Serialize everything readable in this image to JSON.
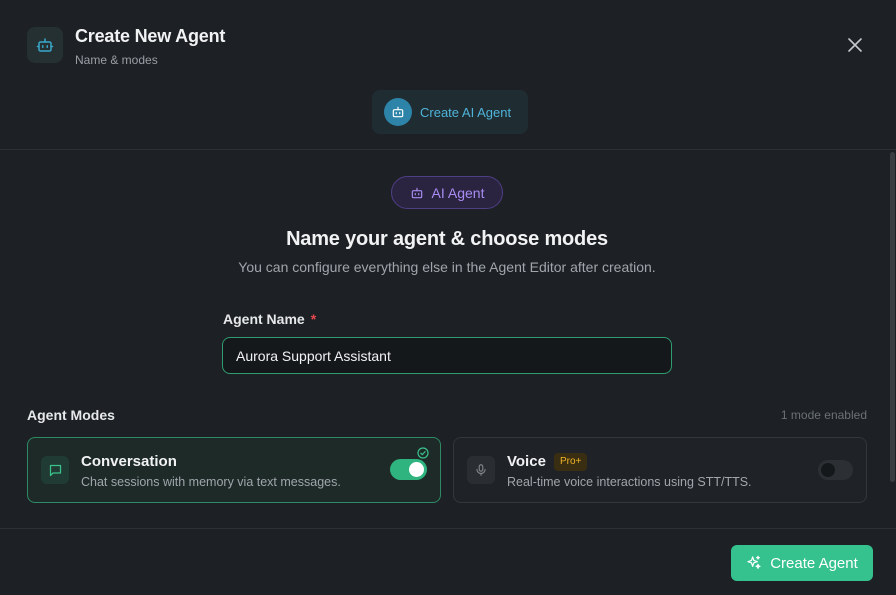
{
  "header": {
    "title": "Create New Agent",
    "subtitle": "Name & modes",
    "step_label": "Create AI Agent",
    "icon": "bot-icon"
  },
  "main": {
    "badge_label": "AI Agent",
    "heading": "Name your agent & choose modes",
    "description": "You can configure everything else in the Agent Editor after creation.",
    "name_field": {
      "label": "Agent Name",
      "required_mark": "*",
      "value": "Aurora Support Assistant"
    },
    "modes": {
      "title": "Agent Modes",
      "count_text": "1 mode enabled",
      "items": [
        {
          "title": "Conversation",
          "description": "Chat sessions with memory via text messages.",
          "enabled": true,
          "icon": "chat-bubble-icon"
        },
        {
          "title": "Voice",
          "tag": "Pro+",
          "description": "Real-time voice interactions using STT/TTS.",
          "enabled": false,
          "icon": "microphone-icon"
        }
      ]
    }
  },
  "footer": {
    "create_label": "Create Agent",
    "icon": "sparkles-icon"
  },
  "colors": {
    "accent_green": "#35c28f",
    "accent_purple": "#a88cf2",
    "accent_blue": "#4fb3d9",
    "pro_gold": "#f0b429"
  }
}
